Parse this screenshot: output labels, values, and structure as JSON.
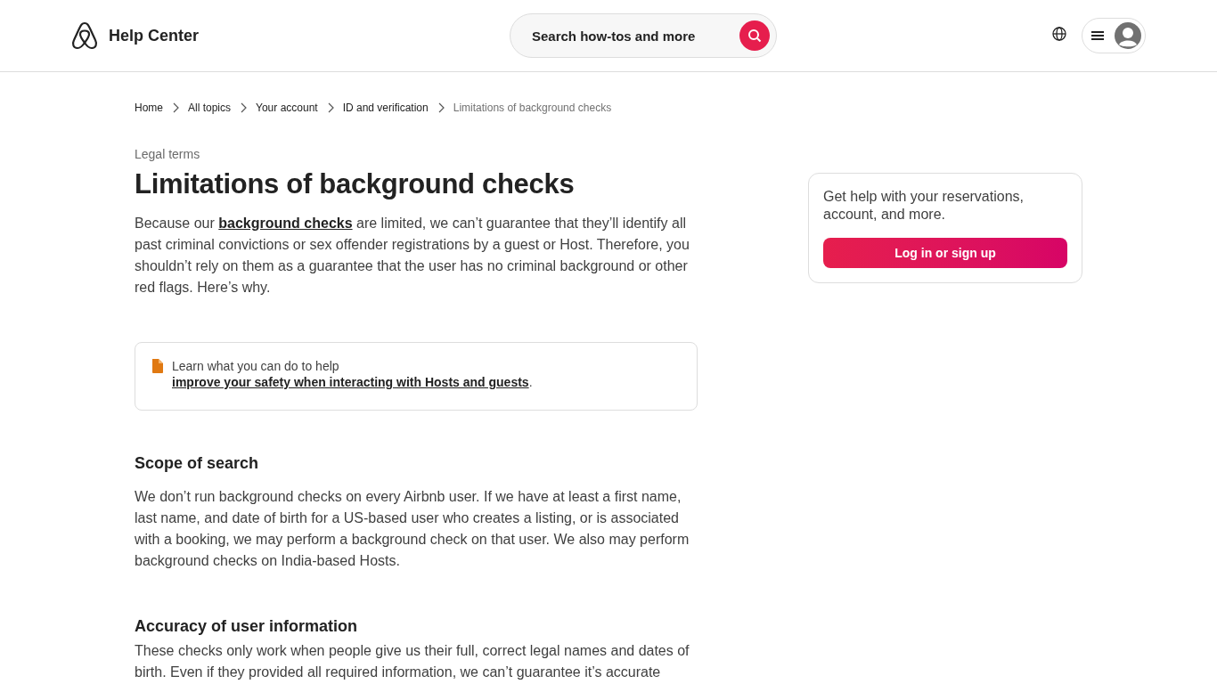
{
  "header": {
    "title": "Help Center",
    "search": {
      "placeholder": "Search how-tos and more"
    }
  },
  "breadcrumbs": [
    {
      "label": "Home",
      "current": false
    },
    {
      "label": "All topics",
      "current": false
    },
    {
      "label": "Your account",
      "current": false
    },
    {
      "label": "ID and verification",
      "current": false
    },
    {
      "label": "Limitations of background checks",
      "current": true
    }
  ],
  "article": {
    "category": "Legal terms",
    "title": "Limitations of background checks",
    "intro": {
      "before": "Because our",
      "link": "background checks",
      "after": "are limited, we can’t guarantee that they’ll identify all past criminal convictions or sex offender registrations by a guest or Host. Therefore, you shouldn’t rely on them as a guarantee that the user has no criminal background or other red flags. Here’s why."
    },
    "callout": {
      "before": "Learn what you can do to help",
      "link": "improve your safety when interacting with Hosts and guests",
      "after": "."
    },
    "sections": [
      {
        "heading": "Scope of search",
        "text": "We don’t run background checks on every Airbnb user. If we have at least a first name, last name, and date of birth for a US-based user who creates a listing, or is associated with a booking, we may perform a background check on that user. We also may perform background checks on India-based Hosts."
      },
      {
        "heading": "Accuracy of user information",
        "text": "These checks only work when people give us their full, correct legal names and dates of birth. Even if they provided all required information, we can’t guarantee it’s accurate"
      }
    ]
  },
  "sidebar_card": {
    "text": "Get help with your reservations, account, and more.",
    "button": "Log in or sign up"
  }
}
